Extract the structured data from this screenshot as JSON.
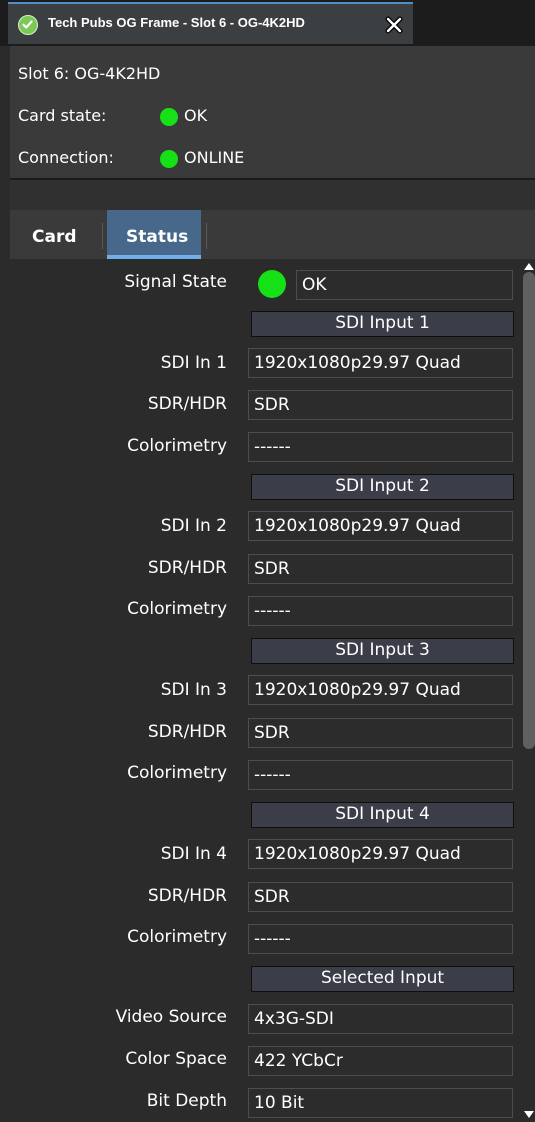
{
  "window": {
    "tab_title": "Tech Pubs OG Frame - Slot 6 - OG-4K2HD",
    "tab_status_icon": "check-circle-icon",
    "close_icon": "close-x-icon"
  },
  "info": {
    "slot": "Slot 6: OG-4K2HD",
    "card_state_label": "Card state:",
    "card_state_value": "OK",
    "connection_label": "Connection:",
    "connection_value": "ONLINE",
    "status_color": "#16e116"
  },
  "tabs": [
    {
      "label": "Card",
      "selected": false
    },
    {
      "label": "Status",
      "selected": true
    }
  ],
  "status": {
    "signal_state_label": "Signal State",
    "signal_state_value": "OK",
    "sections": [
      {
        "header": "SDI Input 1",
        "rows": [
          {
            "label": "SDI In 1",
            "value": "1920x1080p29.97 Quad"
          },
          {
            "label": "SDR/HDR",
            "value": "SDR"
          },
          {
            "label": "Colorimetry",
            "value": "------"
          }
        ]
      },
      {
        "header": "SDI Input 2",
        "rows": [
          {
            "label": "SDI In 2",
            "value": "1920x1080p29.97 Quad"
          },
          {
            "label": "SDR/HDR",
            "value": "SDR"
          },
          {
            "label": "Colorimetry",
            "value": "------"
          }
        ]
      },
      {
        "header": "SDI Input 3",
        "rows": [
          {
            "label": "SDI In 3",
            "value": "1920x1080p29.97 Quad"
          },
          {
            "label": "SDR/HDR",
            "value": "SDR"
          },
          {
            "label": "Colorimetry",
            "value": "------"
          }
        ]
      },
      {
        "header": "SDI Input 4",
        "rows": [
          {
            "label": "SDI In 4",
            "value": "1920x1080p29.97 Quad"
          },
          {
            "label": "SDR/HDR",
            "value": "SDR"
          },
          {
            "label": "Colorimetry",
            "value": "------"
          }
        ]
      },
      {
        "header": "Selected Input",
        "rows": [
          {
            "label": "Video Source",
            "value": "4x3G-SDI"
          },
          {
            "label": "Color Space",
            "value": "422 YCbCr"
          },
          {
            "label": "Bit Depth",
            "value": "10 Bit"
          }
        ]
      }
    ]
  },
  "scrollbar": {
    "position": 0.0,
    "visible_fraction": 0.57
  }
}
